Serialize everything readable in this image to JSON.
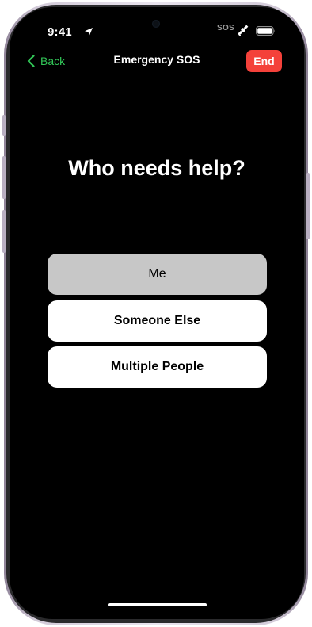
{
  "status_bar": {
    "time": "9:41",
    "sos_label": "SOS",
    "icons": [
      "location-arrow-icon",
      "satellite-icon",
      "battery-icon"
    ]
  },
  "nav": {
    "back_label": "Back",
    "title": "Emergency SOS",
    "end_label": "End"
  },
  "main": {
    "question": "Who needs help?",
    "options": [
      {
        "label": "Me",
        "selected": true
      },
      {
        "label": "Someone Else",
        "selected": false
      },
      {
        "label": "Multiple People",
        "selected": false
      }
    ]
  },
  "colors": {
    "background": "#000000",
    "back_accent": "#32c758",
    "end_button": "#f4413a",
    "selected_option": "#c7c7c7",
    "option": "#ffffff"
  }
}
